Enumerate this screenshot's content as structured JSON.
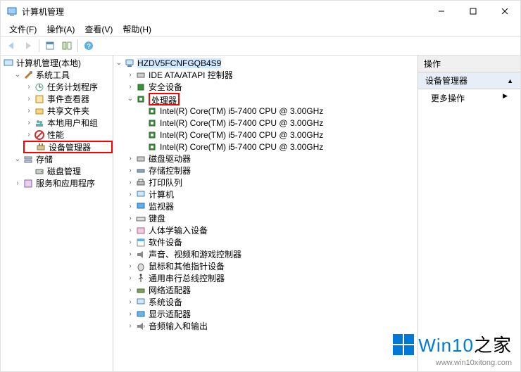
{
  "window": {
    "title": "计算机管理",
    "min_tip": "最小化",
    "max_tip": "最大化",
    "close_tip": "关闭"
  },
  "menu": {
    "file": "文件(F)",
    "action": "操作(A)",
    "view": "查看(V)",
    "help": "帮助(H)"
  },
  "left_tree": {
    "root": "计算机管理(本地)",
    "system_tools": "系统工具",
    "task_scheduler": "任务计划程序",
    "event_viewer": "事件查看器",
    "shared_folders": "共享文件夹",
    "local_users": "本地用户和组",
    "performance": "性能",
    "device_manager": "设备管理器",
    "storage": "存储",
    "disk_mgmt": "磁盘管理",
    "services_apps": "服务和应用程序"
  },
  "mid_tree": {
    "computer": "HZDV5FCNFGQB4S9",
    "ide": "IDE ATA/ATAPI 控制器",
    "security": "安全设备",
    "processors": "处理器",
    "cpu": [
      "Intel(R) Core(TM) i5-7400 CPU @ 3.00GHz",
      "Intel(R) Core(TM) i5-7400 CPU @ 3.00GHz",
      "Intel(R) Core(TM) i5-7400 CPU @ 3.00GHz",
      "Intel(R) Core(TM) i5-7400 CPU @ 3.00GHz"
    ],
    "disk_drives": "磁盘驱动器",
    "storage_ctrl": "存储控制器",
    "print_queues": "打印队列",
    "computers": "计算机",
    "monitors": "监视器",
    "keyboards": "键盘",
    "hid": "人体学输入设备",
    "software": "软件设备",
    "sound": "声音、视频和游戏控制器",
    "mouse": "鼠标和其他指针设备",
    "usb": "通用串行总线控制器",
    "network": "网络适配器",
    "system": "系统设备",
    "display": "显示适配器",
    "audio_io": "音频输入和输出"
  },
  "right": {
    "header": "操作",
    "section": "设备管理器",
    "more": "更多操作"
  },
  "watermark": {
    "brand_a": "Win10",
    "brand_b": "之家",
    "url": "www.win10xitong.com"
  }
}
